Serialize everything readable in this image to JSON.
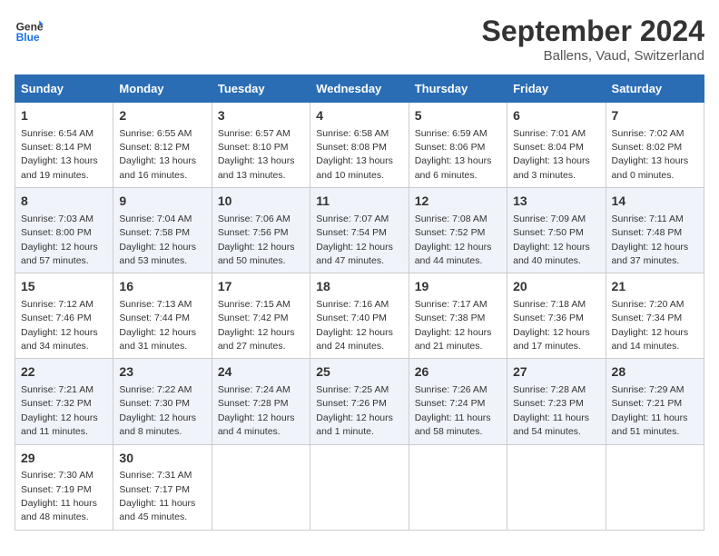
{
  "header": {
    "logo_line1": "General",
    "logo_line2": "Blue",
    "month": "September 2024",
    "location": "Ballens, Vaud, Switzerland"
  },
  "days_of_week": [
    "Sunday",
    "Monday",
    "Tuesday",
    "Wednesday",
    "Thursday",
    "Friday",
    "Saturday"
  ],
  "weeks": [
    [
      {
        "day": "1",
        "sunrise": "6:54 AM",
        "sunset": "8:14 PM",
        "daylight": "13 hours and 19 minutes."
      },
      {
        "day": "2",
        "sunrise": "6:55 AM",
        "sunset": "8:12 PM",
        "daylight": "13 hours and 16 minutes."
      },
      {
        "day": "3",
        "sunrise": "6:57 AM",
        "sunset": "8:10 PM",
        "daylight": "13 hours and 13 minutes."
      },
      {
        "day": "4",
        "sunrise": "6:58 AM",
        "sunset": "8:08 PM",
        "daylight": "13 hours and 10 minutes."
      },
      {
        "day": "5",
        "sunrise": "6:59 AM",
        "sunset": "8:06 PM",
        "daylight": "13 hours and 6 minutes."
      },
      {
        "day": "6",
        "sunrise": "7:01 AM",
        "sunset": "8:04 PM",
        "daylight": "13 hours and 3 minutes."
      },
      {
        "day": "7",
        "sunrise": "7:02 AM",
        "sunset": "8:02 PM",
        "daylight": "13 hours and 0 minutes."
      }
    ],
    [
      {
        "day": "8",
        "sunrise": "7:03 AM",
        "sunset": "8:00 PM",
        "daylight": "12 hours and 57 minutes."
      },
      {
        "day": "9",
        "sunrise": "7:04 AM",
        "sunset": "7:58 PM",
        "daylight": "12 hours and 53 minutes."
      },
      {
        "day": "10",
        "sunrise": "7:06 AM",
        "sunset": "7:56 PM",
        "daylight": "12 hours and 50 minutes."
      },
      {
        "day": "11",
        "sunrise": "7:07 AM",
        "sunset": "7:54 PM",
        "daylight": "12 hours and 47 minutes."
      },
      {
        "day": "12",
        "sunrise": "7:08 AM",
        "sunset": "7:52 PM",
        "daylight": "12 hours and 44 minutes."
      },
      {
        "day": "13",
        "sunrise": "7:09 AM",
        "sunset": "7:50 PM",
        "daylight": "12 hours and 40 minutes."
      },
      {
        "day": "14",
        "sunrise": "7:11 AM",
        "sunset": "7:48 PM",
        "daylight": "12 hours and 37 minutes."
      }
    ],
    [
      {
        "day": "15",
        "sunrise": "7:12 AM",
        "sunset": "7:46 PM",
        "daylight": "12 hours and 34 minutes."
      },
      {
        "day": "16",
        "sunrise": "7:13 AM",
        "sunset": "7:44 PM",
        "daylight": "12 hours and 31 minutes."
      },
      {
        "day": "17",
        "sunrise": "7:15 AM",
        "sunset": "7:42 PM",
        "daylight": "12 hours and 27 minutes."
      },
      {
        "day": "18",
        "sunrise": "7:16 AM",
        "sunset": "7:40 PM",
        "daylight": "12 hours and 24 minutes."
      },
      {
        "day": "19",
        "sunrise": "7:17 AM",
        "sunset": "7:38 PM",
        "daylight": "12 hours and 21 minutes."
      },
      {
        "day": "20",
        "sunrise": "7:18 AM",
        "sunset": "7:36 PM",
        "daylight": "12 hours and 17 minutes."
      },
      {
        "day": "21",
        "sunrise": "7:20 AM",
        "sunset": "7:34 PM",
        "daylight": "12 hours and 14 minutes."
      }
    ],
    [
      {
        "day": "22",
        "sunrise": "7:21 AM",
        "sunset": "7:32 PM",
        "daylight": "12 hours and 11 minutes."
      },
      {
        "day": "23",
        "sunrise": "7:22 AM",
        "sunset": "7:30 PM",
        "daylight": "12 hours and 8 minutes."
      },
      {
        "day": "24",
        "sunrise": "7:24 AM",
        "sunset": "7:28 PM",
        "daylight": "12 hours and 4 minutes."
      },
      {
        "day": "25",
        "sunrise": "7:25 AM",
        "sunset": "7:26 PM",
        "daylight": "12 hours and 1 minute."
      },
      {
        "day": "26",
        "sunrise": "7:26 AM",
        "sunset": "7:24 PM",
        "daylight": "11 hours and 58 minutes."
      },
      {
        "day": "27",
        "sunrise": "7:28 AM",
        "sunset": "7:23 PM",
        "daylight": "11 hours and 54 minutes."
      },
      {
        "day": "28",
        "sunrise": "7:29 AM",
        "sunset": "7:21 PM",
        "daylight": "11 hours and 51 minutes."
      }
    ],
    [
      {
        "day": "29",
        "sunrise": "7:30 AM",
        "sunset": "7:19 PM",
        "daylight": "11 hours and 48 minutes."
      },
      {
        "day": "30",
        "sunrise": "7:31 AM",
        "sunset": "7:17 PM",
        "daylight": "11 hours and 45 minutes."
      },
      null,
      null,
      null,
      null,
      null
    ]
  ]
}
